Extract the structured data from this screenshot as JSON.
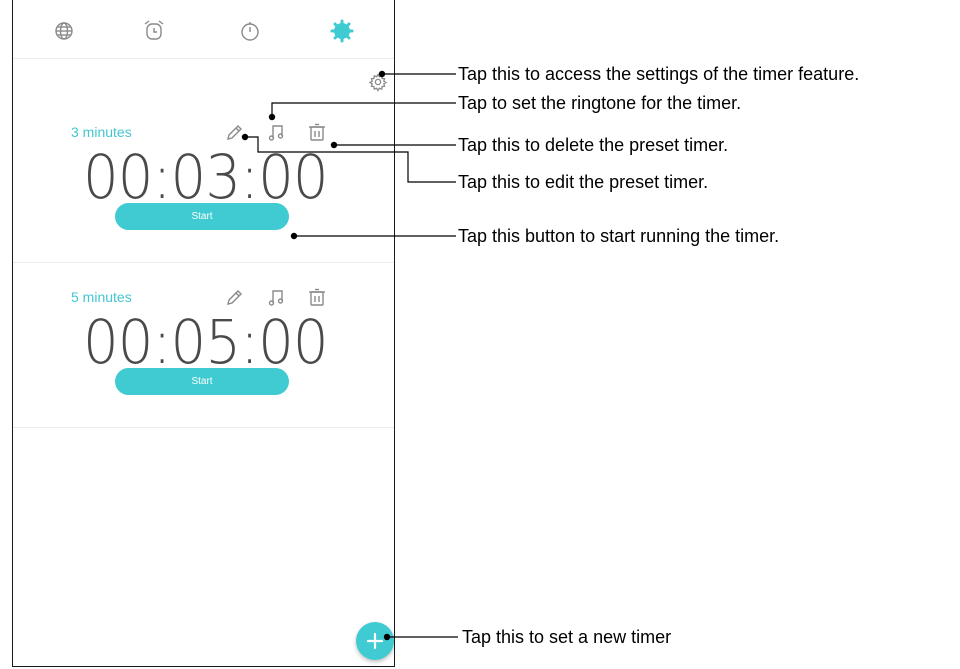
{
  "tabs": [
    {
      "icon": "globe-icon"
    },
    {
      "icon": "alarm-clock-icon"
    },
    {
      "icon": "stopwatch-icon"
    },
    {
      "icon": "timer-icon",
      "active": true
    }
  ],
  "colors": {
    "accent": "#3fcbd1",
    "label": "#43c6cf",
    "icon_gray": "#8a8a8a",
    "time_text": "#4a4a4a"
  },
  "settings_icon": "gear-icon",
  "timers": [
    {
      "name": "3 minutes",
      "time": "00:03:00",
      "start_label": "Start"
    },
    {
      "name": "5 minutes",
      "time": "00:05:00",
      "start_label": "Start"
    }
  ],
  "timer_icons": [
    "pencil-icon",
    "music-note-icon",
    "trash-icon"
  ],
  "fab_icon": "plus-icon",
  "callouts": {
    "settings": "Tap this to access the settings of the timer feature.",
    "ringtone": "Tap to set the ringtone for the timer.",
    "delete": "Tap this to delete the preset timer.",
    "edit": "Tap this to edit the preset timer.",
    "start": "Tap this button to start running the timer.",
    "new_timer": "Tap this to set a new timer"
  }
}
